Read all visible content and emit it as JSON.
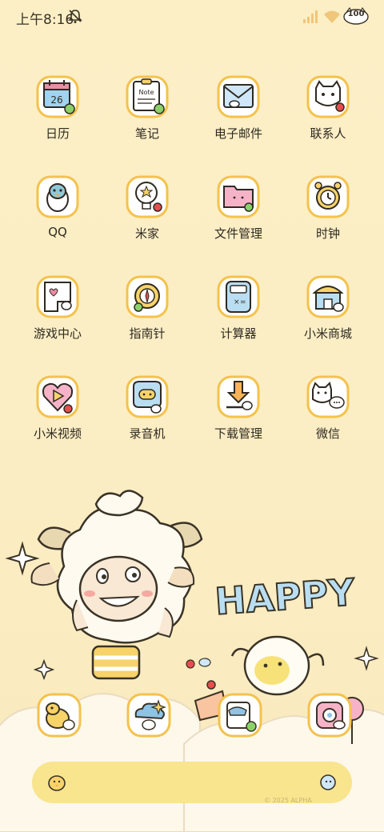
{
  "status_bar": {
    "time": "上午8:16",
    "battery": "100"
  },
  "apps": [
    {
      "label": "日历",
      "icon": "calendar-icon",
      "icon_text": "26"
    },
    {
      "label": "笔记",
      "icon": "notes-icon",
      "icon_text": "Note"
    },
    {
      "label": "电子邮件",
      "icon": "mail-icon"
    },
    {
      "label": "联系人",
      "icon": "contacts-icon"
    },
    {
      "label": "QQ",
      "icon": "qq-penguin-icon"
    },
    {
      "label": "米家",
      "icon": "mijia-bulb-icon"
    },
    {
      "label": "文件管理",
      "icon": "folder-icon"
    },
    {
      "label": "时钟",
      "icon": "clock-icon"
    },
    {
      "label": "游戏中心",
      "icon": "game-center-icon"
    },
    {
      "label": "指南针",
      "icon": "compass-icon"
    },
    {
      "label": "计算器",
      "icon": "calculator-icon"
    },
    {
      "label": "小米商城",
      "icon": "store-icon"
    },
    {
      "label": "小米视频",
      "icon": "video-play-icon"
    },
    {
      "label": "录音机",
      "icon": "recorder-icon"
    },
    {
      "label": "下载管理",
      "icon": "download-icon"
    },
    {
      "label": "微信",
      "icon": "wechat-cat-icon"
    }
  ],
  "wallpaper": {
    "happy_text": "HAPPY"
  },
  "dock": [
    {
      "icon": "dock-chick-icon"
    },
    {
      "icon": "dock-cloud-icon"
    },
    {
      "icon": "dock-book-icon"
    },
    {
      "icon": "dock-camera-icon"
    }
  ],
  "search_bar": {
    "watermark": "© 2025 ALPHA"
  },
  "colors": {
    "background": "#fbeec4",
    "icon_border": "#f4c24c",
    "search_bar": "#f8e58e"
  }
}
